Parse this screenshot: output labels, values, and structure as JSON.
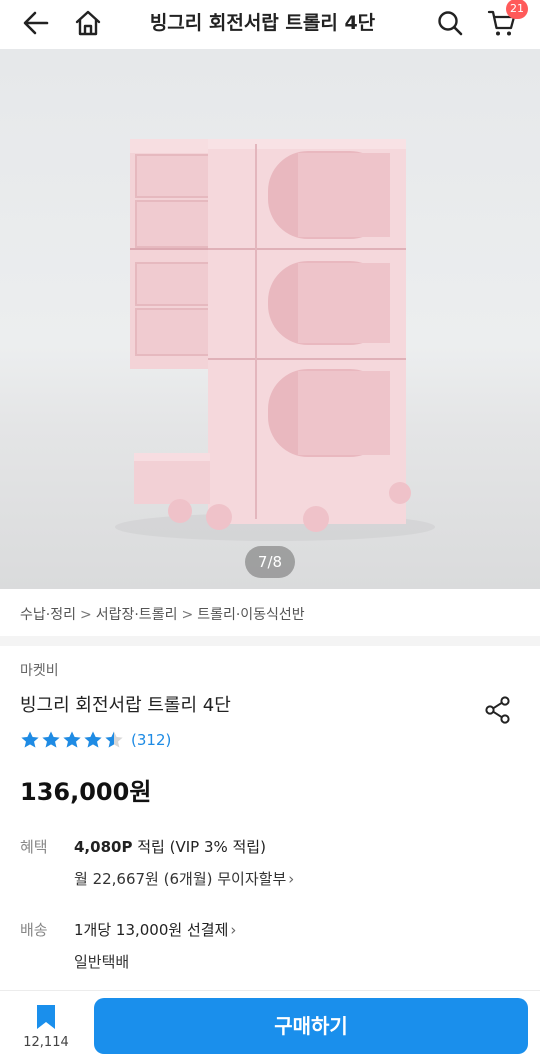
{
  "header": {
    "title": "빙그리 회전서랍 트롤리 4단",
    "cart_count": "21",
    "icons": [
      "back-arrow-icon",
      "home-icon",
      "search-icon",
      "cart-icon"
    ]
  },
  "gallery": {
    "counter": "7/8"
  },
  "breadcrumb": {
    "items": [
      "수납·정리",
      "서랍장·트롤리",
      "트롤리·이동식선반"
    ],
    "separator": ">"
  },
  "product": {
    "seller": "마켓비",
    "name": "빙그리 회전서랍 트롤리 4단",
    "rating": 4.5,
    "rating_max": 5,
    "review_count": "(312)",
    "price": "136,000원",
    "star_color": "#1e8be4"
  },
  "benefit": {
    "label": "혜택",
    "points": "4,080P",
    "points_suffix": " 적립",
    "vip": " (VIP 3% 적립)",
    "installment": "월 22,667원 (6개월) 무이자할부"
  },
  "shipping": {
    "label": "배송",
    "fee": "1개당 13,000원",
    "fee_suffix": " 선결제",
    "type": "일반택배"
  },
  "bottom": {
    "wish_count": "12,114",
    "buy_label": "구매하기",
    "accent_color": "#1a8fec"
  }
}
